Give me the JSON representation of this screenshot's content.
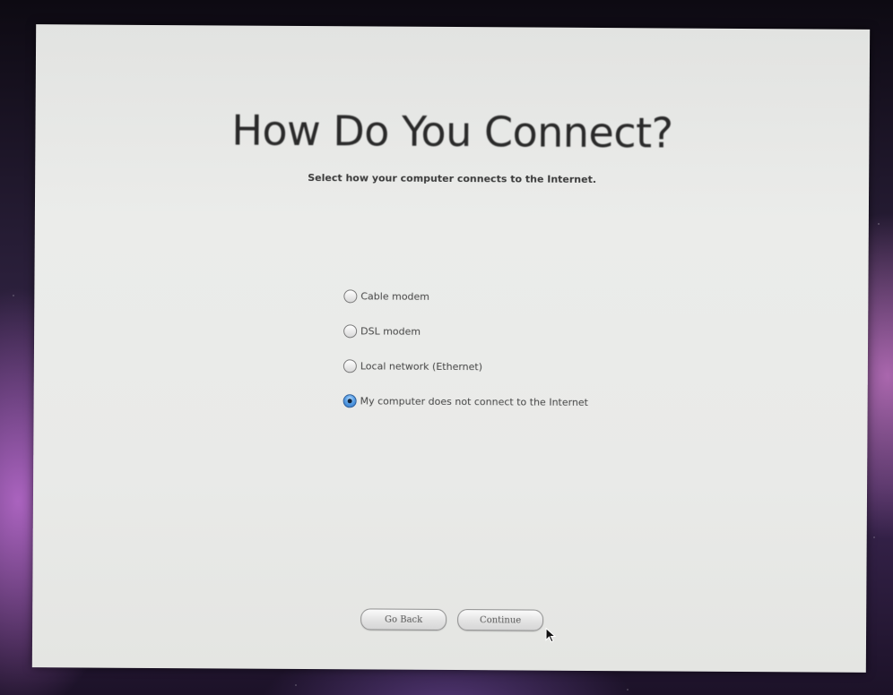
{
  "setup": {
    "title": "How Do You Connect?",
    "subtitle": "Select how your computer connects to the Internet.",
    "options": [
      {
        "label": "Cable modem",
        "selected": false
      },
      {
        "label": "DSL modem",
        "selected": false
      },
      {
        "label": "Local network (Ethernet)",
        "selected": false
      },
      {
        "label": "My computer does not connect to the Internet",
        "selected": true
      }
    ],
    "buttons": {
      "back_label": "Go Back",
      "continue_label": "Continue"
    }
  },
  "icons": {
    "cursor": "arrow-pointer-icon"
  },
  "colors": {
    "panel_background": "#e9eae8",
    "selected_radio": "#4a90d9"
  }
}
